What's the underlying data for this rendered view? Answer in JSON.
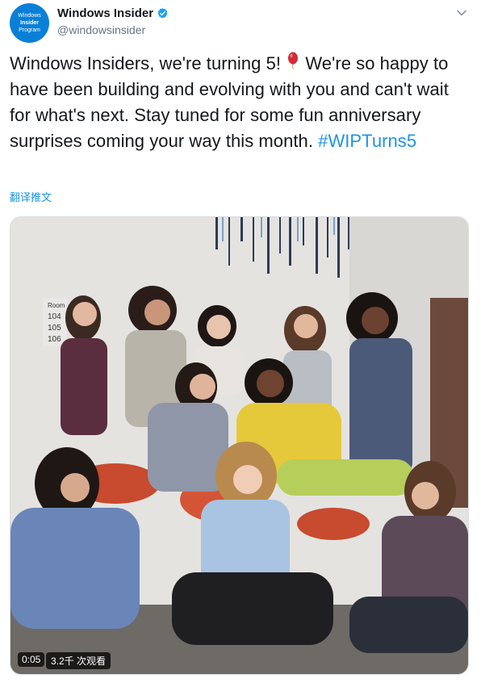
{
  "author": {
    "avatar_lines": [
      "Windows",
      "Insider",
      "Program"
    ],
    "display_name": "Windows Insider",
    "handle": "@windowsinsider",
    "verified": true
  },
  "tweet": {
    "text_before_emoji": "Windows Insiders, we're turning 5! ",
    "emoji": "balloon-icon",
    "text_after_emoji": " We're so happy to have been building and evolving with you and can't wait for what's next. Stay tuned for some fun anniversary surprises coming your way this month.",
    "hashtag": "#WIPTurns5",
    "translate_label": "翻译推文"
  },
  "video": {
    "timestamp": "0:05",
    "views": "3.2千 次观看",
    "sign_text": [
      "Room",
      "104",
      "105",
      "106"
    ]
  },
  "colors": {
    "link": "#1b95e0",
    "avatar_bg": "#0a7fd8",
    "text": "#14171a",
    "muted": "#657786"
  }
}
